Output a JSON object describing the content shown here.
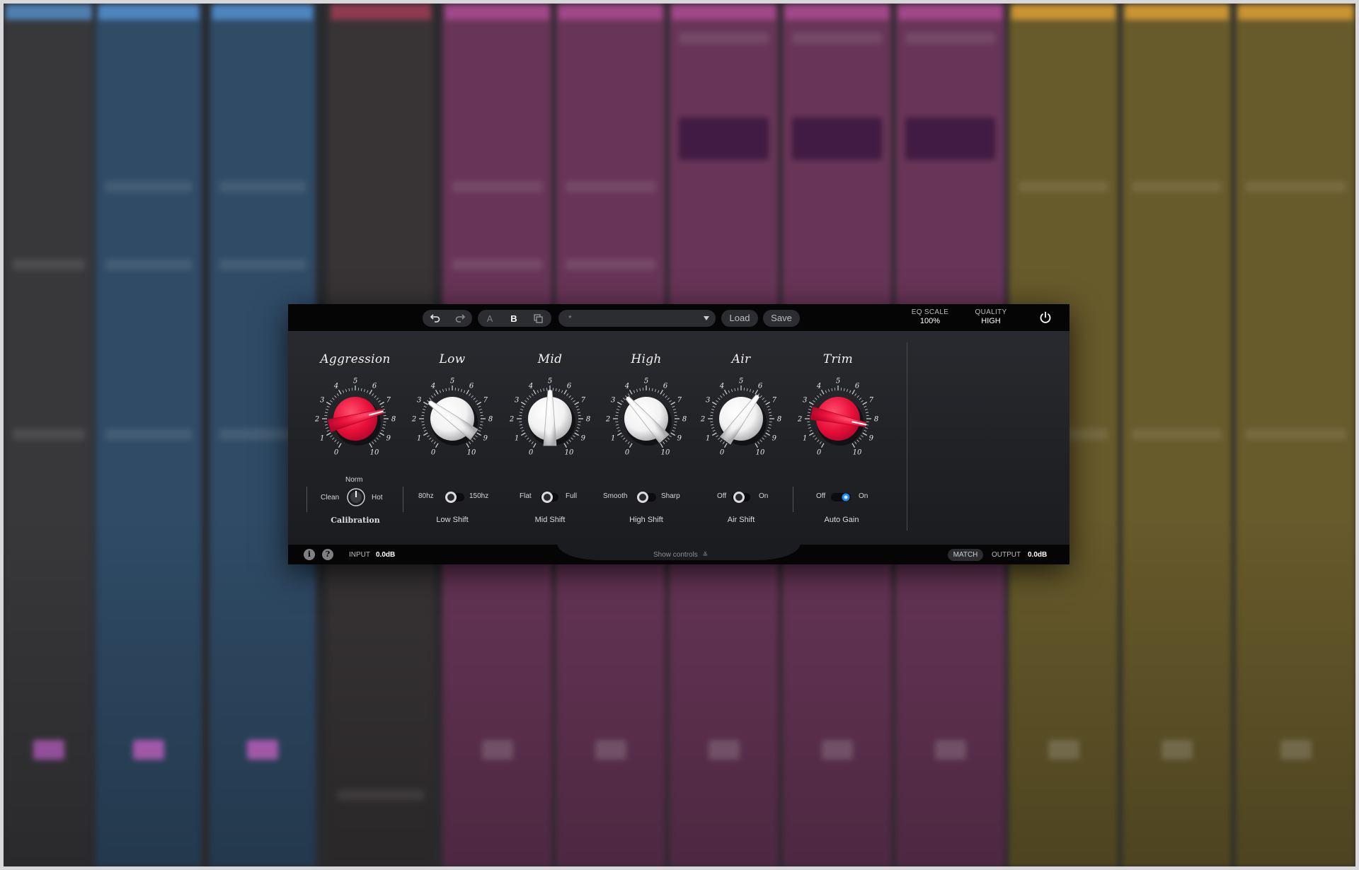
{
  "topbar": {
    "undo_icon": "undo-arrow",
    "redo_icon": "redo-arrow",
    "ab_a": "A",
    "ab_b": "B",
    "copy_icon": "copy-icon",
    "preset_name": "*",
    "load_label": "Load",
    "save_label": "Save",
    "eq_scale": {
      "label": "EQ SCALE",
      "value": "100%"
    },
    "quality": {
      "label": "QUALITY",
      "value": "HIGH"
    },
    "power_icon": "power-icon"
  },
  "knobs": [
    {
      "key": "aggression",
      "title": "Aggression",
      "color": "#e8113a",
      "value": 7.5
    },
    {
      "key": "low",
      "title": "Low",
      "color": "#f2f2f2",
      "value": 3.2
    },
    {
      "key": "mid",
      "title": "Mid",
      "color": "#f2f2f2",
      "value": 5.0
    },
    {
      "key": "high",
      "title": "High",
      "color": "#f2f2f2",
      "value": 3.6
    },
    {
      "key": "air",
      "title": "Air",
      "color": "#f2f2f2",
      "value": 6.2
    },
    {
      "key": "trim",
      "title": "Trim",
      "color": "#e8113a",
      "value": 8.4
    }
  ],
  "scale_numbers": [
    "0",
    "1",
    "2",
    "3",
    "4",
    "5",
    "6",
    "7",
    "8",
    "9",
    "10"
  ],
  "controls": {
    "calibration": {
      "label": "Calibration",
      "left": "Clean",
      "top": "Norm",
      "right": "Hot"
    },
    "low_shift": {
      "label": "Low Shift",
      "left": "80hz",
      "right": "150hz"
    },
    "mid_shift": {
      "label": "Mid Shift",
      "left": "Flat",
      "right": "Full"
    },
    "high_shift": {
      "label": "High Shift",
      "left": "Smooth",
      "right": "Sharp"
    },
    "air_shift": {
      "label": "Air Shift",
      "left": "Off",
      "right": "On"
    },
    "auto_gain": {
      "label": "Auto Gain",
      "left": "Off",
      "right": "On",
      "state": "On",
      "accent": "#1b8cff"
    }
  },
  "bottombar": {
    "info_icon": "i",
    "help_icon": "?",
    "input_label": "INPUT",
    "input_value": "0.0dB",
    "show_controls": "Show controls",
    "match_label": "MATCH",
    "output_label": "OUTPUT",
    "output_value": "0.0dB"
  },
  "background_colors": [
    "#3a3a3c",
    "#2d4a66",
    "#2d4a66",
    "#3a3436",
    "#6b3456",
    "#6b3456",
    "#6b3456",
    "#6b3456",
    "#6b3456",
    "#6b5a26",
    "#6b5a26",
    "#6b5a26"
  ]
}
